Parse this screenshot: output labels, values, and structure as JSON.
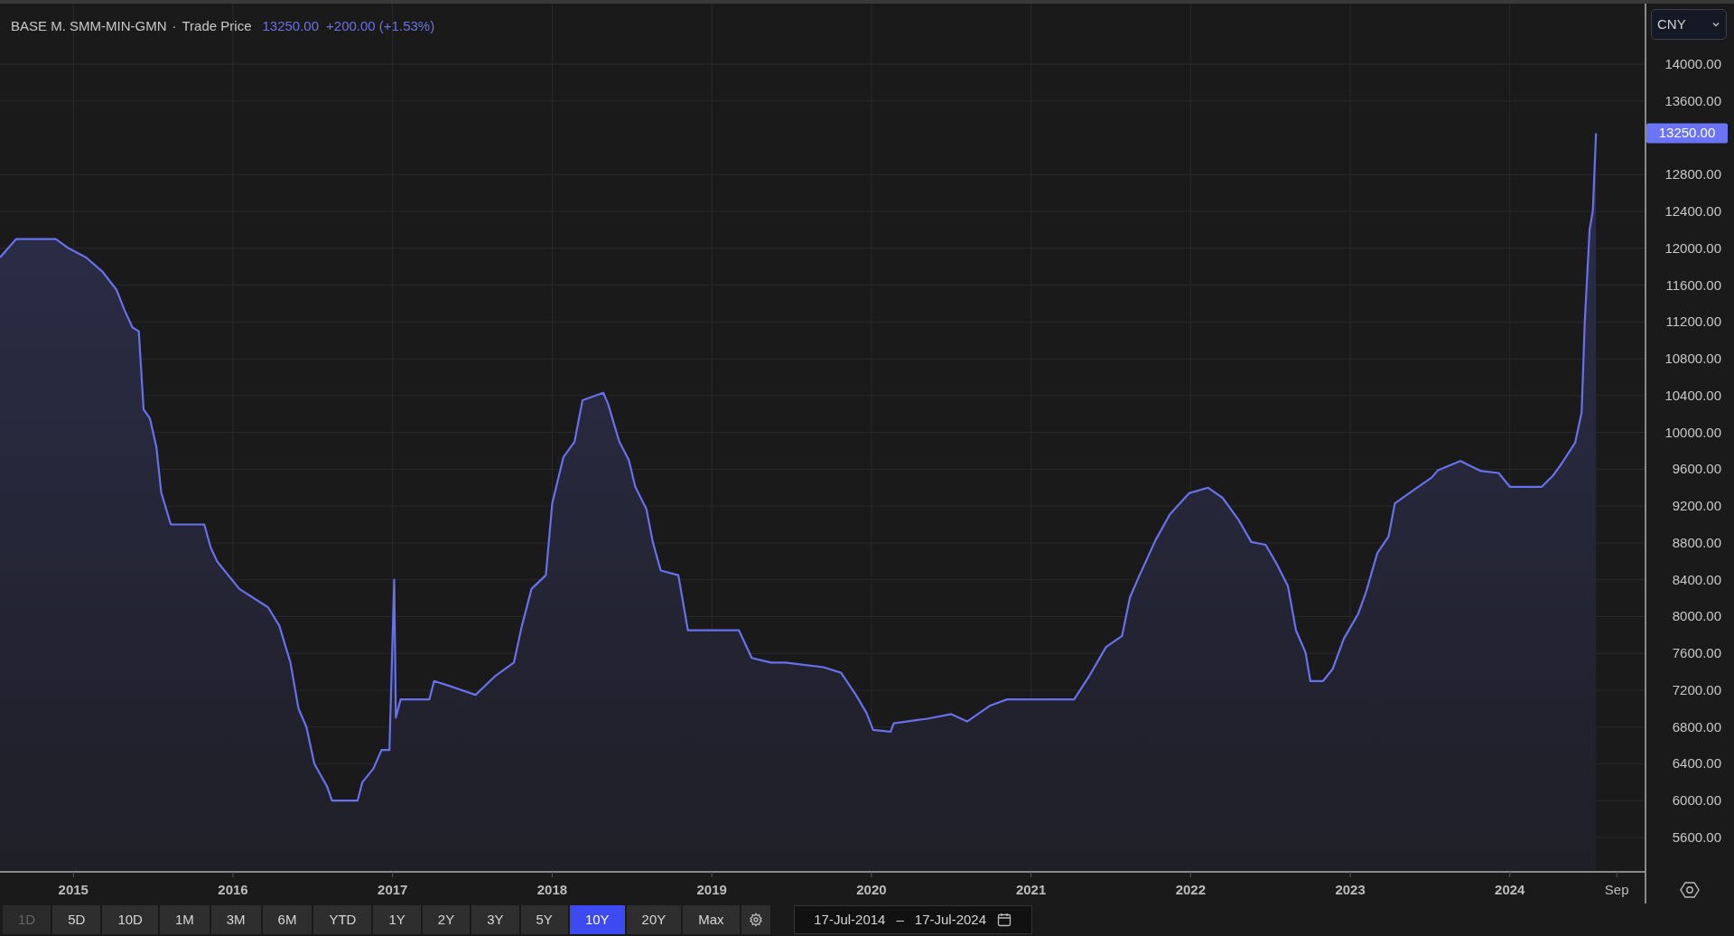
{
  "header": {
    "symbol": "BASE M. SMM-MIN-GMN",
    "separator": "·",
    "price": "13250.00",
    "change": "+200.00 (+1.53%)"
  },
  "currency_select": {
    "value": "CNY"
  },
  "chart": {
    "price_marker": "13250.00",
    "chart_data": {
      "type": "area",
      "grid": true,
      "xlim": [
        2014.54,
        2024.85
      ],
      "ylim": [
        5227,
        14658
      ],
      "xticks": [
        {
          "value": 2015,
          "label": "2015"
        },
        {
          "value": 2016,
          "label": "2016"
        },
        {
          "value": 2017,
          "label": "2017"
        },
        {
          "value": 2018,
          "label": "2018"
        },
        {
          "value": 2019,
          "label": "2019"
        },
        {
          "value": 2020,
          "label": "2020"
        },
        {
          "value": 2021,
          "label": "2021"
        },
        {
          "value": 2022,
          "label": "2022"
        },
        {
          "value": 2023,
          "label": "2023"
        },
        {
          "value": 2024,
          "label": "2024"
        },
        {
          "value": 2024.67,
          "label": "Sep"
        }
      ],
      "yticks": [
        {
          "value": 14000,
          "label": "14000.00"
        },
        {
          "value": 13600,
          "label": "13600.00"
        },
        {
          "value": 12800,
          "label": "12800.00"
        },
        {
          "value": 12400,
          "label": "12400.00"
        },
        {
          "value": 12000,
          "label": "12000.00"
        },
        {
          "value": 11600,
          "label": "11600.00"
        },
        {
          "value": 11200,
          "label": "11200.00"
        },
        {
          "value": 10800,
          "label": "10800.00"
        },
        {
          "value": 10400,
          "label": "10400.00"
        },
        {
          "value": 10000,
          "label": "10000.00"
        },
        {
          "value": 9600,
          "label": "9600.00"
        },
        {
          "value": 9200,
          "label": "9200.00"
        },
        {
          "value": 8800,
          "label": "8800.00"
        },
        {
          "value": 8400,
          "label": "8400.00"
        },
        {
          "value": 8000,
          "label": "8000.00"
        },
        {
          "value": 7600,
          "label": "7600.00"
        },
        {
          "value": 7200,
          "label": "7200.00"
        },
        {
          "value": 6800,
          "label": "6800.00"
        },
        {
          "value": 6400,
          "label": "6400.00"
        },
        {
          "value": 6000,
          "label": "6000.00"
        },
        {
          "value": 5600,
          "label": "5600.00"
        }
      ],
      "x": [
        2014.54,
        2014.64,
        2014.89,
        2014.97,
        2015.08,
        2015.18,
        2015.27,
        2015.32,
        2015.37,
        2015.41,
        2015.44,
        2015.48,
        2015.52,
        2015.55,
        2015.61,
        2015.82,
        2015.86,
        2015.9,
        2016.04,
        2016.22,
        2016.29,
        2016.36,
        2016.41,
        2016.46,
        2016.51,
        2016.59,
        2016.62,
        2016.78,
        2016.81,
        2016.88,
        2016.93,
        2016.98,
        2017.01,
        2017.02,
        2017.05,
        2017.23,
        2017.26,
        2017.35,
        2017.52,
        2017.64,
        2017.76,
        2017.81,
        2017.87,
        2017.96,
        2018.0,
        2018.07,
        2018.14,
        2018.19,
        2018.32,
        2018.35,
        2018.42,
        2018.48,
        2018.52,
        2018.59,
        2018.63,
        2018.68,
        2018.79,
        2018.85,
        2019.17,
        2019.25,
        2019.37,
        2019.46,
        2019.7,
        2019.81,
        2019.91,
        2019.97,
        2020.01,
        2020.12,
        2020.14,
        2020.35,
        2020.5,
        2020.6,
        2020.74,
        2020.85,
        2021.27,
        2021.36,
        2021.47,
        2021.57,
        2021.62,
        2021.68,
        2021.78,
        2021.87,
        2021.99,
        2022.11,
        2022.2,
        2022.3,
        2022.38,
        2022.47,
        2022.54,
        2022.61,
        2022.66,
        2022.72,
        2022.75,
        2022.83,
        2022.89,
        2022.96,
        2023.05,
        2023.1,
        2023.17,
        2023.24,
        2023.28,
        2023.41,
        2023.51,
        2023.55,
        2023.69,
        2023.82,
        2023.93,
        2024.0,
        2024.2,
        2024.27,
        2024.32,
        2024.41,
        2024.45,
        2024.47,
        2024.5,
        2024.52,
        2024.54
      ],
      "series": [
        {
          "name": "Trade Price",
          "color": "#6870ec",
          "values": [
            11900,
            12100,
            12100,
            12000,
            11900,
            11750,
            11550,
            11330,
            11140,
            11100,
            10250,
            10150,
            9840,
            9350,
            9000,
            9000,
            8750,
            8600,
            8300,
            8100,
            7900,
            7500,
            7000,
            6800,
            6400,
            6150,
            6000,
            6000,
            6200,
            6350,
            6550,
            6550,
            8400,
            6900,
            7100,
            7100,
            7300,
            7250,
            7150,
            7350,
            7500,
            7900,
            8300,
            8450,
            9230,
            9730,
            9900,
            10350,
            10430,
            10310,
            9900,
            9700,
            9410,
            9170,
            8810,
            8500,
            8450,
            7850,
            7850,
            7550,
            7500,
            7500,
            7450,
            7390,
            7130,
            6950,
            6770,
            6750,
            6840,
            6890,
            6940,
            6860,
            7030,
            7100,
            7100,
            7340,
            7670,
            7790,
            8210,
            8450,
            8830,
            9110,
            9340,
            9400,
            9290,
            9050,
            8810,
            8780,
            8570,
            8330,
            7850,
            7610,
            7300,
            7300,
            7430,
            7760,
            8030,
            8270,
            8690,
            8870,
            9230,
            9390,
            9510,
            9590,
            9690,
            9580,
            9560,
            9410,
            9410,
            9530,
            9650,
            9890,
            10220,
            11210,
            12200,
            12410,
            13250
          ]
        }
      ]
    }
  },
  "range_buttons": [
    {
      "label": "1D",
      "selected": false,
      "disabled": true
    },
    {
      "label": "5D",
      "selected": false,
      "disabled": false
    },
    {
      "label": "10D",
      "selected": false,
      "disabled": false
    },
    {
      "label": "1M",
      "selected": false,
      "disabled": false
    },
    {
      "label": "3M",
      "selected": false,
      "disabled": false
    },
    {
      "label": "6M",
      "selected": false,
      "disabled": false
    },
    {
      "label": "YTD",
      "selected": false,
      "disabled": false
    },
    {
      "label": "1Y",
      "selected": false,
      "disabled": false
    },
    {
      "label": "2Y",
      "selected": false,
      "disabled": false
    },
    {
      "label": "3Y",
      "selected": false,
      "disabled": false
    },
    {
      "label": "5Y",
      "selected": false,
      "disabled": false
    },
    {
      "label": "10Y",
      "selected": true,
      "disabled": false
    },
    {
      "label": "20Y",
      "selected": false,
      "disabled": false
    },
    {
      "label": "Max",
      "selected": false,
      "disabled": false
    }
  ],
  "date_range": {
    "start": "17-Jul-2014",
    "separator": "–",
    "end": "17-Jul-2024"
  }
}
